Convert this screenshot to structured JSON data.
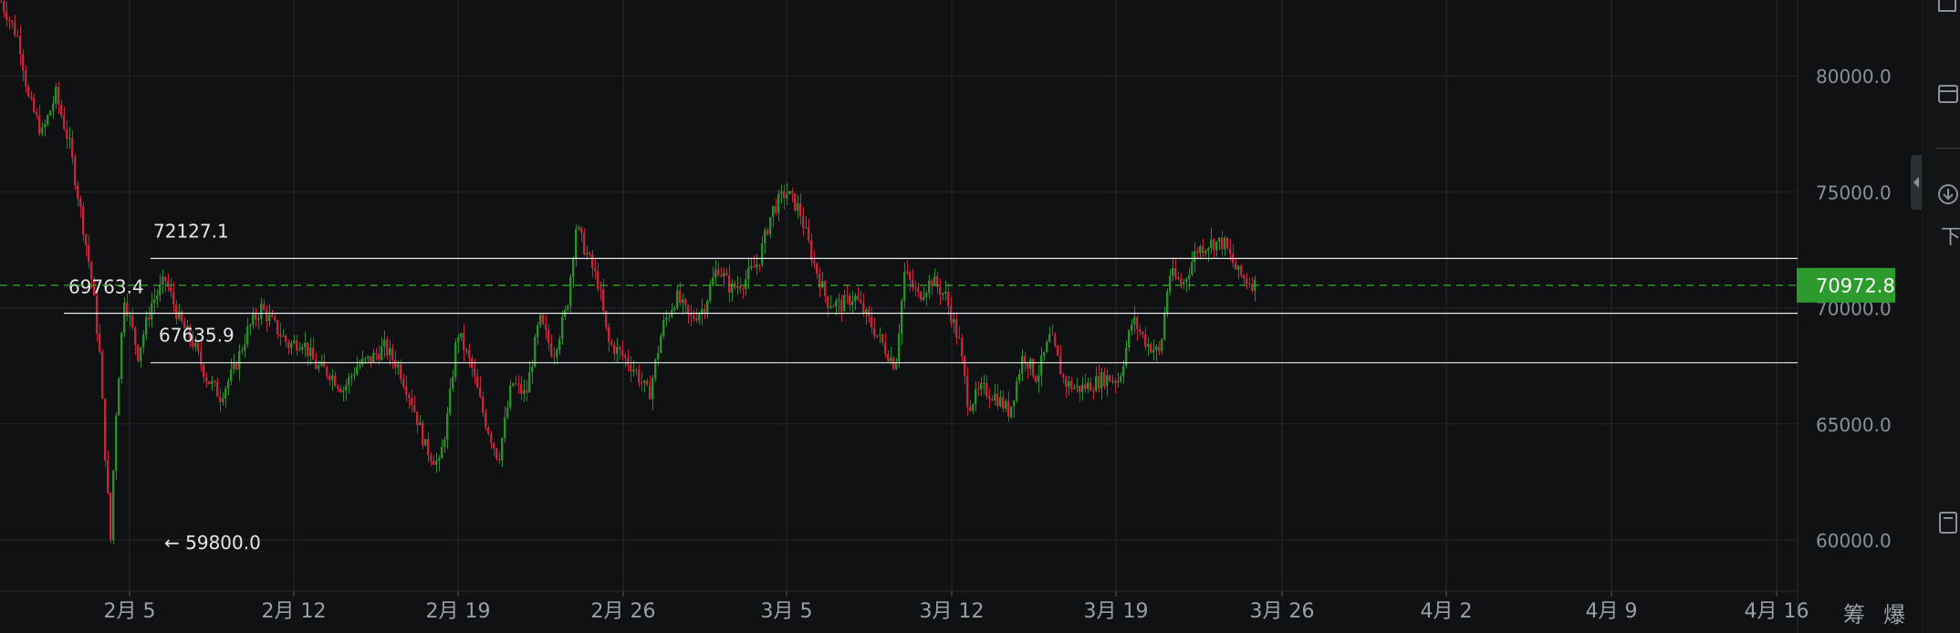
{
  "chart_data": {
    "type": "candlestick",
    "x_tick_labels": [
      "2月 5",
      "2月 12",
      "2月 19",
      "2月 26",
      "3月 5",
      "3月 12",
      "3月 19",
      "3月 26",
      "4月 2",
      "4月 9",
      "4月 16"
    ],
    "y_tick_labels": [
      "80000.0",
      "75000.0",
      "70000.0",
      "65000.0",
      "60000.0"
    ],
    "ylim": [
      58000,
      83500
    ],
    "grid": true,
    "colors": {
      "up": "#2a8f2a",
      "down": "#c2263a",
      "background": "#0f1113",
      "grid": "#24272b",
      "level_line": "#e8e8e8",
      "current_line": "#3fa832",
      "price_tag": "#2c9a2c"
    },
    "current_price": 70972.8,
    "levels": [
      {
        "label": "72127.1",
        "price": 72127.1
      },
      {
        "label": "69763.4",
        "price": 69763.4
      },
      {
        "label": "67635.9",
        "price": 67635.9
      }
    ],
    "low_marker": {
      "label": "← 59800.0",
      "price": 59800.0
    },
    "price_path": [
      [
        0,
        83200
      ],
      [
        20,
        81500
      ],
      [
        30,
        79000
      ],
      [
        45,
        77500
      ],
      [
        60,
        79200
      ],
      [
        75,
        77000
      ],
      [
        90,
        73500
      ],
      [
        100,
        71000
      ],
      [
        108,
        68000
      ],
      [
        115,
        63000
      ],
      [
        120,
        60000
      ],
      [
        125,
        65000
      ],
      [
        135,
        70500
      ],
      [
        150,
        68000
      ],
      [
        165,
        70200
      ],
      [
        180,
        71200
      ],
      [
        195,
        69500
      ],
      [
        210,
        68500
      ],
      [
        225,
        67000
      ],
      [
        240,
        66200
      ],
      [
        255,
        67300
      ],
      [
        270,
        69000
      ],
      [
        285,
        70000
      ],
      [
        300,
        69200
      ],
      [
        315,
        68400
      ],
      [
        330,
        68600
      ],
      [
        345,
        67500
      ],
      [
        360,
        67200
      ],
      [
        375,
        66500
      ],
      [
        390,
        67500
      ],
      [
        405,
        67800
      ],
      [
        420,
        68300
      ],
      [
        435,
        67500
      ],
      [
        450,
        66000
      ],
      [
        465,
        64000
      ],
      [
        480,
        63200
      ],
      [
        490,
        65500
      ],
      [
        500,
        69000
      ],
      [
        515,
        67500
      ],
      [
        530,
        65200
      ],
      [
        545,
        63500
      ],
      [
        560,
        66800
      ],
      [
        575,
        66200
      ],
      [
        590,
        69500
      ],
      [
        605,
        68000
      ],
      [
        620,
        70000
      ],
      [
        630,
        73500
      ],
      [
        640,
        72500
      ],
      [
        655,
        71000
      ],
      [
        665,
        68500
      ],
      [
        680,
        68000
      ],
      [
        695,
        67300
      ],
      [
        710,
        66200
      ],
      [
        725,
        69200
      ],
      [
        740,
        70500
      ],
      [
        755,
        69500
      ],
      [
        770,
        70000
      ],
      [
        785,
        71800
      ],
      [
        800,
        70800
      ],
      [
        815,
        71200
      ],
      [
        830,
        72000
      ],
      [
        845,
        74200
      ],
      [
        860,
        75000
      ],
      [
        875,
        74200
      ],
      [
        890,
        72000
      ],
      [
        905,
        70300
      ],
      [
        920,
        70100
      ],
      [
        935,
        70500
      ],
      [
        950,
        69500
      ],
      [
        965,
        68500
      ],
      [
        980,
        67500
      ],
      [
        990,
        71500
      ],
      [
        1005,
        70500
      ],
      [
        1020,
        71200
      ],
      [
        1035,
        70500
      ],
      [
        1050,
        68500
      ],
      [
        1060,
        65800
      ],
      [
        1075,
        66500
      ],
      [
        1090,
        66200
      ],
      [
        1105,
        65500
      ],
      [
        1120,
        68000
      ],
      [
        1135,
        67000
      ],
      [
        1150,
        68800
      ],
      [
        1165,
        66800
      ],
      [
        1180,
        66500
      ],
      [
        1195,
        66700
      ],
      [
        1210,
        67000
      ],
      [
        1225,
        66900
      ],
      [
        1240,
        69500
      ],
      [
        1255,
        68500
      ],
      [
        1270,
        68000
      ],
      [
        1280,
        71500
      ],
      [
        1295,
        71000
      ],
      [
        1310,
        72500
      ],
      [
        1325,
        72800
      ],
      [
        1340,
        72800
      ],
      [
        1355,
        71500
      ],
      [
        1365,
        71200
      ],
      [
        1375,
        71000
      ]
    ]
  },
  "panel": {
    "icon_download_label": "下"
  },
  "bottom_tools": {
    "chips_label": "筹",
    "burst_label": "爆"
  }
}
